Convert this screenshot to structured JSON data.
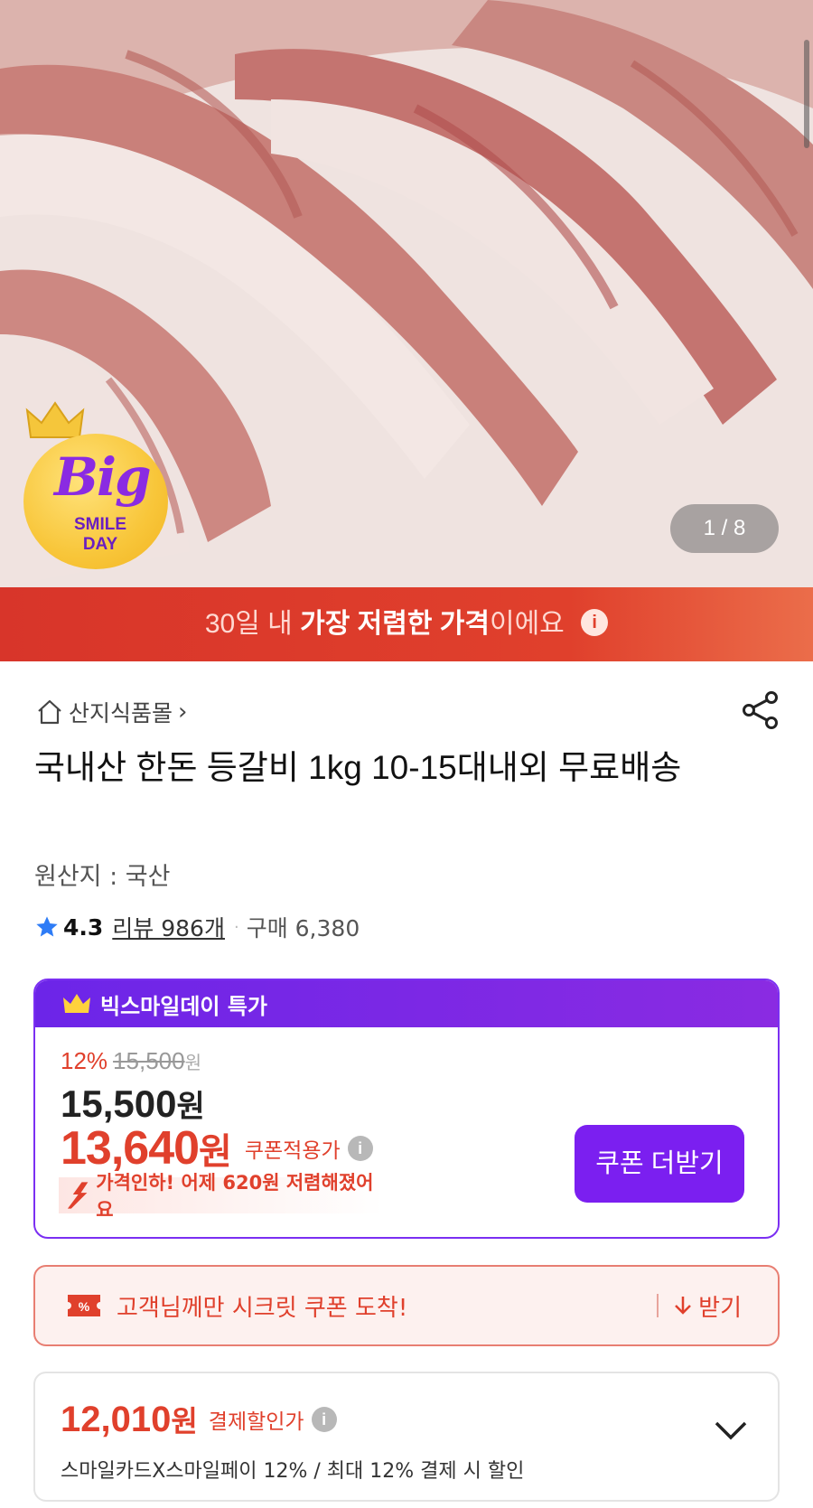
{
  "hero": {
    "counter": "1 / 8",
    "badge": {
      "big": "Big",
      "line1": "SMILE",
      "line2": "DAY"
    }
  },
  "banner": {
    "pre": "30일 내 ",
    "bold": "가장 저렴한 가격",
    "post": "이에요",
    "info_icon": "i"
  },
  "shop": {
    "name": "산지식품몰",
    "chevron": "›"
  },
  "product": {
    "title": "국내산 한돈 등갈비 1kg 10-15대내외 무료배송",
    "origin": "원산지 : 국산",
    "rating": "4.3",
    "review": "리뷰 986개",
    "purchase": "구매 6,380",
    "dot": "·"
  },
  "deal": {
    "header": "빅스마일데이 특가",
    "discount_pct": "12%",
    "original_price": "15,500",
    "original_won": "원",
    "price": "15,500",
    "price_won": "원",
    "coupon_price": "13,640",
    "coupon_won": "원",
    "coupon_label": "쿠폰적용가",
    "info_icon": "i",
    "drop_text": "가격인하! 어제 620원 저렴해졌어요",
    "coupon_button": "쿠폰 더받기"
  },
  "secret": {
    "ticket_symbol": "%",
    "text": "고객님께만 시크릿 쿠폰 도착!",
    "get": "받기"
  },
  "pay": {
    "price": "12,010",
    "won": "원",
    "label": "결제할인가",
    "info_icon": "i",
    "desc": "스마일카드X스마일페이 12% / 최대 12% 결제 시 할인"
  },
  "colors": {
    "accent_red": "#e0402c",
    "accent_purple": "#7b1ff0",
    "star_blue": "#2e7cf6"
  }
}
